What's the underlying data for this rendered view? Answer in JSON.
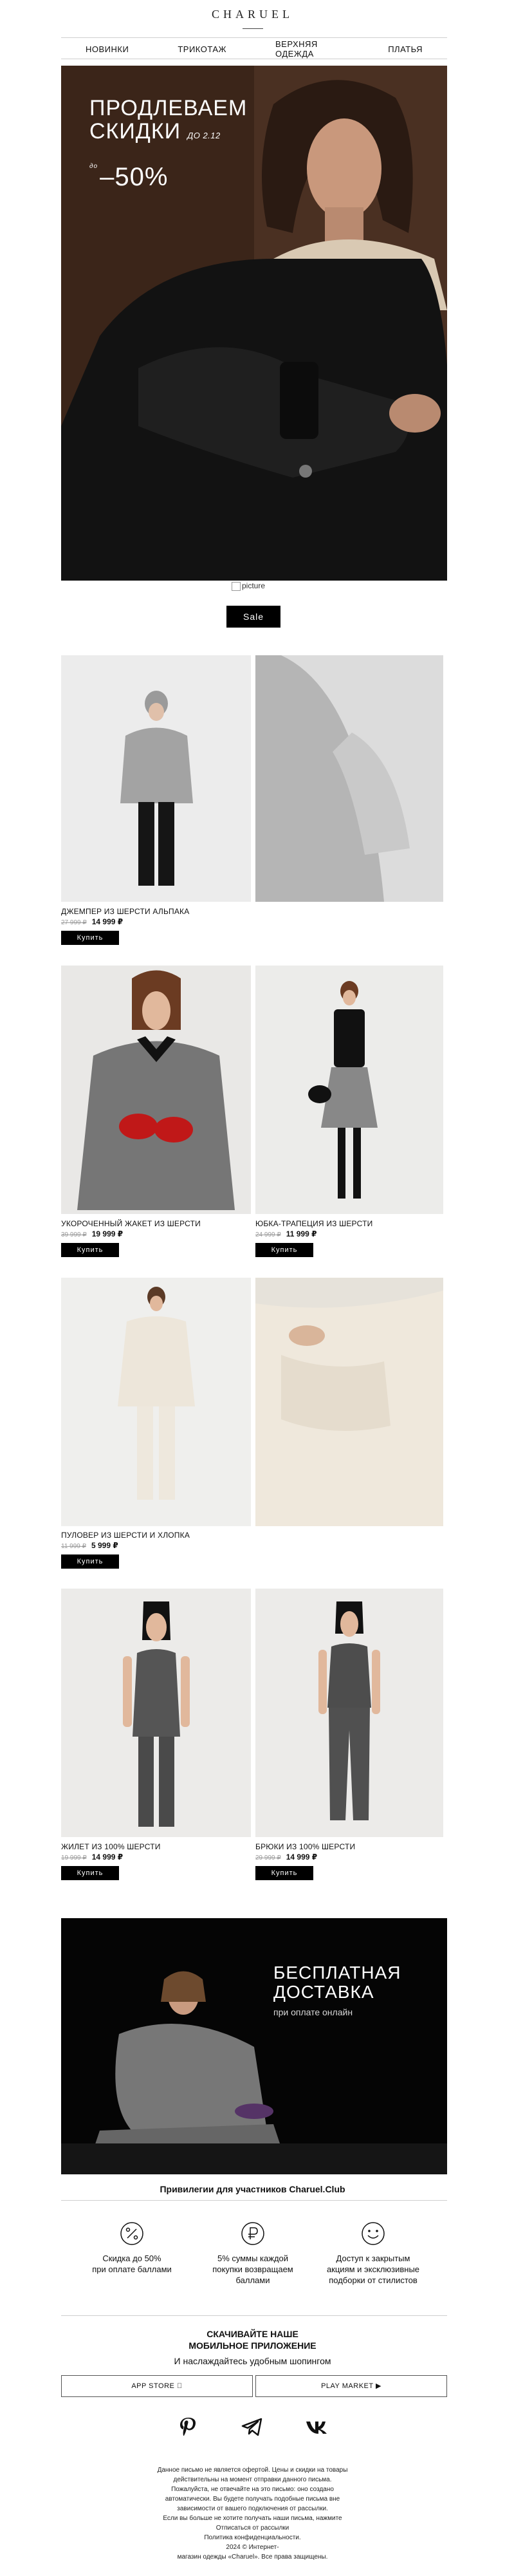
{
  "brand": {
    "logo": "CHARUEL"
  },
  "nav": [
    "НОВИНКИ",
    "ТРИКОТАЖ",
    "ВЕРХНЯЯ ОДЕЖДА",
    "ПЛАТЬЯ"
  ],
  "hero": {
    "line1": "ПРОДЛЕВАЕМ",
    "line2": "СКИДКИ",
    "date": "ДО 2.12",
    "prefix": "до",
    "discount": "–50%"
  },
  "broken_image_alt": "picture",
  "sale_button": "Sale",
  "products": [
    {
      "name": "ДЖЕМПЕР ИЗ ШЕРСТИ АЛЬПАКА",
      "old_price": "27 999 ₽",
      "price": "14 999 ₽",
      "buy": "Купить"
    },
    {
      "name": "УКОРОЧЕННЫЙ ЖАКЕТ ИЗ ШЕРСТИ",
      "old_price": "39 999 ₽",
      "price": "19 999 ₽",
      "buy": "Купить"
    },
    {
      "name": "ЮБКА-ТРАПЕЦИЯ ИЗ ШЕРСТИ",
      "old_price": "24 999 ₽",
      "price": "11 999 ₽",
      "buy": "Купить"
    },
    {
      "name": "ПУЛОВЕР ИЗ ШЕРСТИ И ХЛОПКА",
      "old_price": "11 999 ₽",
      "price": "5 999 ₽",
      "buy": "Купить"
    },
    {
      "name": "ЖИЛЕТ ИЗ 100% ШЕРСТИ",
      "old_price": "19 999 ₽",
      "price": "14 999 ₽",
      "buy": "Купить"
    },
    {
      "name": "БРЮКИ ИЗ 100% ШЕРСТИ",
      "old_price": "29 999 ₽",
      "price": "14 999 ₽",
      "buy": "Купить"
    }
  ],
  "promo": {
    "line1": "БЕСПЛАТНАЯ",
    "line2": "ДОСТАВКА",
    "line3": "при оплате онлайн"
  },
  "club": {
    "title": "Привилегии для участников Charuel.Club",
    "perks": [
      {
        "icon": "percent-icon",
        "line1": "Скидка до 50%",
        "line2": "при оплате баллами"
      },
      {
        "icon": "ruble-coin-icon",
        "line1": "5% суммы каждой",
        "line2": "покупки возвращаем",
        "line3": "баллами"
      },
      {
        "icon": "smile-icon",
        "line1": "Доступ к закрытым",
        "line2": "акциям и эксклюзивные",
        "line3": "подборки от стилистов"
      }
    ]
  },
  "app": {
    "title1": "СКАЧИВАЙТЕ НАШЕ",
    "title2": "МОБИЛЬНОЕ ПРИЛОЖЕНИЕ",
    "subtitle": "И наслаждайтесь удобным шопингом",
    "app_store": "APP STORE",
    "play_market": "PLAY MARKET"
  },
  "social": [
    "pinterest-icon",
    "telegram-icon",
    "vk-icon"
  ],
  "footer": [
    "Данное письмо не является офертой. Цены и скидки на товары",
    "действительны на момент отправки данного письма.",
    "Пожалуйста, не отвечайте на это письмо: оно создано",
    "автоматически. Вы будете получать подобные письма вне",
    "зависимости от вашего подключения от рассылки.",
    "Если вы больше не хотите получать наши письма, нажмите",
    "Отписаться от рассылки",
    "Политика конфиденциальности.",
    "2024 © Интернет-",
    "магазин одежды «Charuel». Все права защищены."
  ],
  "colors": {
    "hero_bg": "#3a2418",
    "accent": "#000000"
  }
}
